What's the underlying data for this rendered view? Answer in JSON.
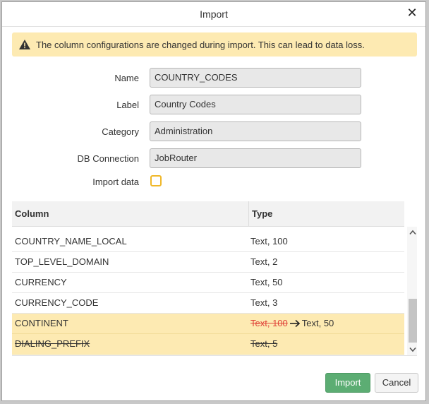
{
  "dialog": {
    "title": "Import",
    "close_glyph": "✕"
  },
  "warning": {
    "icon": "warning-triangle-icon",
    "text": "The column configurations are changed during import. This can lead to data loss."
  },
  "form": {
    "name_label": "Name",
    "name_value": "COUNTRY_CODES",
    "label_label": "Label",
    "label_value": "Country Codes",
    "category_label": "Category",
    "category_value": "Administration",
    "db_label": "DB Connection",
    "db_value": "JobRouter",
    "import_data_label": "Import data",
    "import_data_checked": false
  },
  "table": {
    "headers": {
      "column": "Column",
      "type": "Type"
    },
    "rows": [
      {
        "column": "COUNTRY_NAME_LOCAL",
        "type": "Text, 100",
        "state": "normal"
      },
      {
        "column": "TOP_LEVEL_DOMAIN",
        "type": "Text, 2",
        "state": "normal"
      },
      {
        "column": "CURRENCY",
        "type": "Text, 50",
        "state": "normal"
      },
      {
        "column": "CURRENCY_CODE",
        "type": "Text, 3",
        "state": "normal"
      },
      {
        "column": "CONTINENT",
        "old_type": "Text, 100",
        "new_type": "Text, 50",
        "state": "changed"
      },
      {
        "column": "DIALING_PREFIX",
        "type": "Text, 5",
        "state": "removed"
      }
    ]
  },
  "colors": {
    "warning_bg": "#fdeab2",
    "primary_button": "#5cad73",
    "checkbox_border": "#f0b82a",
    "strike_red": "#e0453a"
  },
  "buttons": {
    "import_label": "Import",
    "cancel_label": "Cancel"
  }
}
